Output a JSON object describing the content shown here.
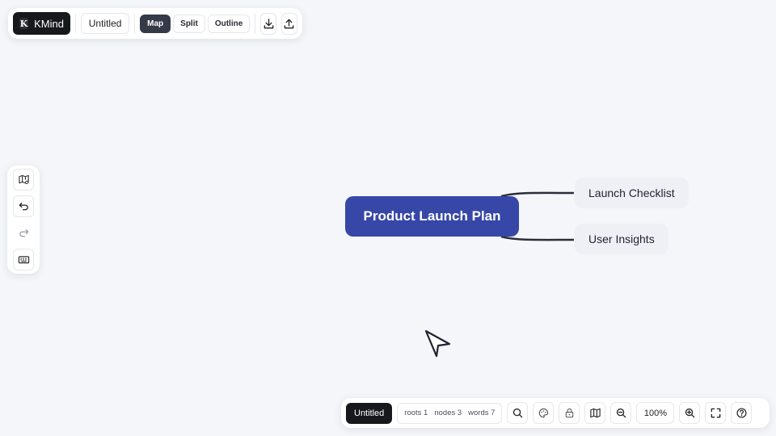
{
  "app": {
    "brand_initial": "K",
    "brand_name": "KMind",
    "doc_title": "Untitled"
  },
  "view_modes": [
    {
      "label": "Map",
      "active": true
    },
    {
      "label": "Split",
      "active": false
    },
    {
      "label": "Outline",
      "active": false
    }
  ],
  "toolbar_icons": [
    "download-icon",
    "upload-icon"
  ],
  "left_toolbar_icons": [
    "map-settings-icon",
    "undo-icon",
    "redo-icon",
    "keyboard-icon"
  ],
  "mindmap": {
    "root": "Product Launch Plan",
    "children": [
      "Launch Checklist",
      "User Insights"
    ]
  },
  "status": {
    "doc_name": "Untitled",
    "roots": "roots 1",
    "nodes": "nodes 3",
    "words": "words 7",
    "zoom": "100%"
  },
  "bottom_icons": [
    "search-icon",
    "theme-palette-icon",
    "lock-icon",
    "minimap-icon",
    "zoom-out-icon",
    "zoom-in-icon",
    "fullscreen-icon",
    "help-icon"
  ],
  "colors": {
    "background": "#f5f6fa",
    "root_node": "#3647a8",
    "child_node": "#eef0f6",
    "dark": "#17181c"
  }
}
